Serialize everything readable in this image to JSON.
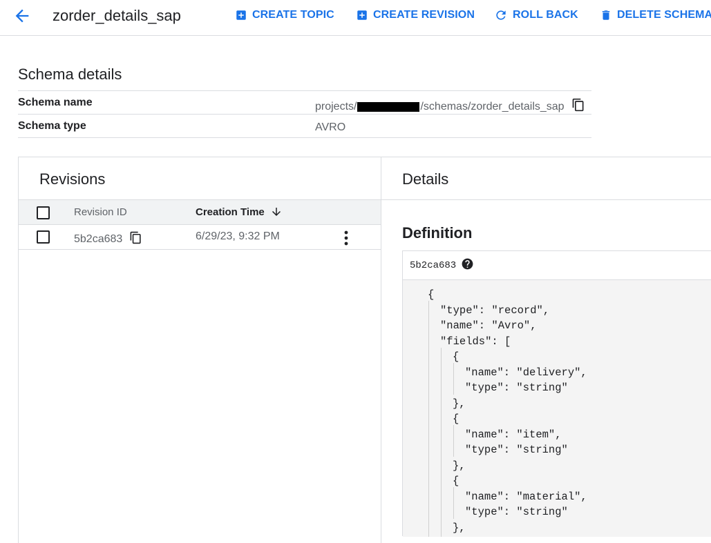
{
  "header": {
    "title": "zorder_details_sap",
    "actions": {
      "create_topic": "CREATE TOPIC",
      "create_revision": "CREATE REVISION",
      "roll_back": "ROLL BACK",
      "delete_schema": "DELETE SCHEMA"
    }
  },
  "schema_details": {
    "title": "Schema details",
    "name_label": "Schema name",
    "name_prefix": "projects/",
    "name_suffix": "/schemas/zorder_details_sap",
    "type_label": "Schema type",
    "type_value": "AVRO"
  },
  "revisions": {
    "title": "Revisions",
    "columns": {
      "revision_id": "Revision ID",
      "creation_time": "Creation Time"
    },
    "rows": [
      {
        "revision_id": "5b2ca683",
        "creation_time": "6/29/23, 9:32 PM"
      }
    ]
  },
  "details": {
    "title": "Details",
    "definition_title": "Definition",
    "revision_id": "5b2ca683",
    "code_lines": [
      "{",
      "\"type\": \"record\",",
      "\"name\": \"Avro\",",
      "\"fields\": [",
      "{",
      "\"name\": \"delivery\",",
      "\"type\": \"string\"",
      "},",
      "{",
      "\"name\": \"item\",",
      "\"type\": \"string\"",
      "},",
      "{",
      "\"name\": \"material\",",
      "\"type\": \"string\"",
      "},"
    ]
  },
  "colors": {
    "accent": "#1a73e8",
    "text": "#202124",
    "muted": "#5f6368",
    "border": "#dadce0"
  },
  "icons": [
    "arrow-back-icon",
    "add-box-icon",
    "refresh-icon",
    "delete-icon",
    "copy-icon",
    "arrow-down-icon",
    "more-vert-icon",
    "help-icon"
  ]
}
